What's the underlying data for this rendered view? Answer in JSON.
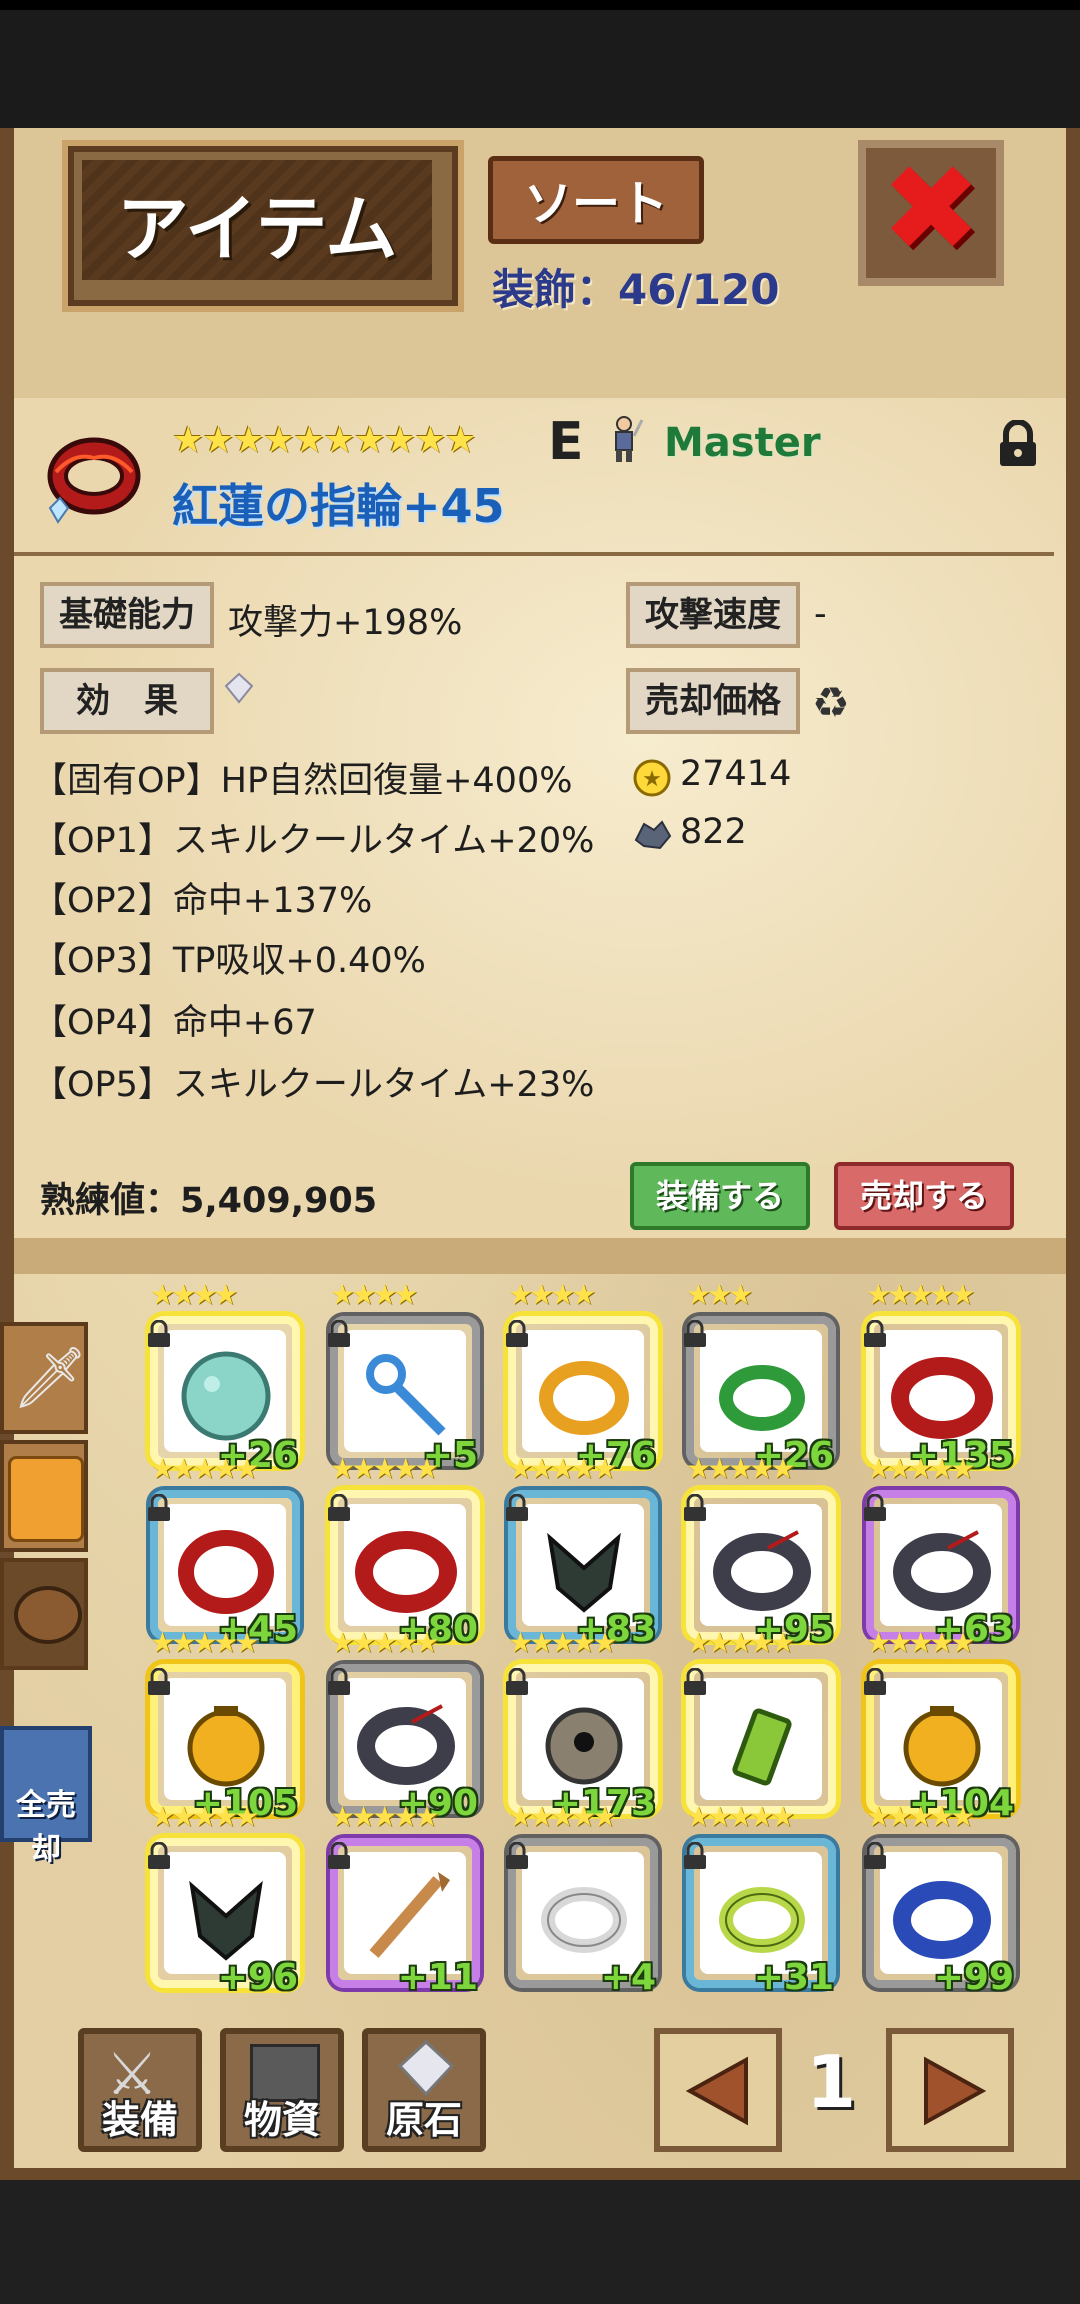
{
  "header": {
    "title": "アイテム",
    "sort_label": "ソート",
    "count_text": "装飾：46/120"
  },
  "item": {
    "stars": "★★★★★★★★★★",
    "grade": "E",
    "owner": "Master",
    "name": "紅蓮の指輪+45",
    "base_label": "基礎能力",
    "base_value": "攻撃力+198%",
    "speed_label": "攻撃速度",
    "speed_value": "-",
    "effect_label": "効　果",
    "price_label": "売却価格",
    "effects": [
      "【固有OP】HP自然回復量+400%",
      "【OP1】スキルクールタイム+20%",
      "【OP2】命中+137%",
      "【OP3】TP吸収+0.40%",
      "【OP4】命中+67",
      "【OP5】スキルクールタイム+23%"
    ],
    "price_gold": "27414",
    "price_ore": "822",
    "mastery_text": "熟練値：5,409,905",
    "equip_label": "装備する",
    "sell_label": "売却する"
  },
  "sidebar": {
    "sell_all_label": "全売却"
  },
  "grid": [
    {
      "plus": "+26",
      "stars": "★★★★",
      "icon": "moon-orb-icon",
      "frame": "gold"
    },
    {
      "plus": "+5",
      "stars": "★★★★",
      "icon": "key-icon",
      "frame": "silver"
    },
    {
      "plus": "+76",
      "stars": "★★★★",
      "icon": "gold-ring-icon",
      "frame": "gold"
    },
    {
      "plus": "+26",
      "stars": "★★★",
      "icon": "green-ring-icon",
      "frame": "silver"
    },
    {
      "plus": "+135",
      "stars": "★★★★★",
      "icon": "crimson-ring-icon",
      "frame": "gold"
    },
    {
      "plus": "+45",
      "stars": "★★★★★",
      "icon": "crimson-ring-icon",
      "frame": "blue"
    },
    {
      "plus": "+80",
      "stars": "★★★★★",
      "icon": "crimson-ring-icon",
      "frame": "gold"
    },
    {
      "plus": "+83",
      "stars": "★★★★★",
      "icon": "dark-amulet-icon",
      "frame": "blue"
    },
    {
      "plus": "+95",
      "stars": "★★★★★",
      "icon": "dark-bracelet-icon",
      "frame": "gold"
    },
    {
      "plus": "+63",
      "stars": "★★★★★",
      "icon": "dark-bracelet-icon",
      "frame": "purple"
    },
    {
      "plus": "+105",
      "stars": "★★★★★",
      "icon": "gold-seal-icon",
      "frame": "gold"
    },
    {
      "plus": "+90",
      "stars": "★★★★★",
      "icon": "dark-bracelet-icon",
      "frame": "silver"
    },
    {
      "plus": "+173",
      "stars": "★★★★★",
      "icon": "eyeball-icon",
      "frame": "gold"
    },
    {
      "plus": "",
      "stars": "★★★★★",
      "icon": "green-potion-icon",
      "frame": "gold"
    },
    {
      "plus": "+104",
      "stars": "★★★★★",
      "icon": "gold-seal-icon",
      "frame": "gold"
    },
    {
      "plus": "+96",
      "stars": "★★★★★",
      "icon": "dark-amulet-icon",
      "frame": "gold"
    },
    {
      "plus": "+11",
      "stars": "★★★★★",
      "icon": "bone-spear-icon",
      "frame": "purple"
    },
    {
      "plus": "+4",
      "stars": "★★★★★",
      "icon": "white-ring-icon",
      "frame": "silver"
    },
    {
      "plus": "+31",
      "stars": "★★★★★",
      "icon": "jade-ring-icon",
      "frame": "blue"
    },
    {
      "plus": "+99",
      "stars": "★★★★★",
      "icon": "sapphire-ring-icon",
      "frame": "silver"
    }
  ],
  "bottom": {
    "equip_tab": "装備",
    "material_tab": "物資",
    "ore_tab": "原石",
    "page": "1"
  }
}
